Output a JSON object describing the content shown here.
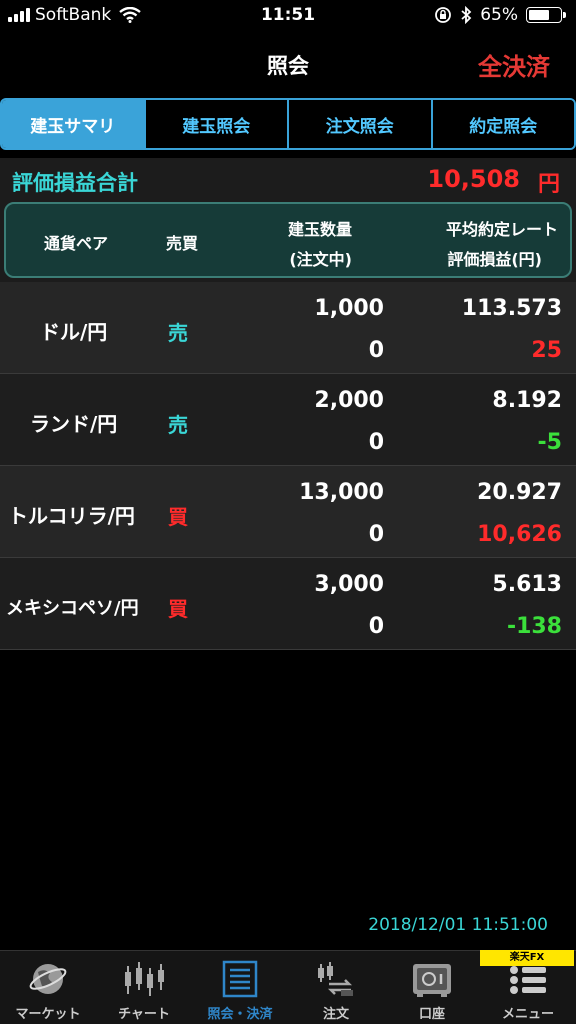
{
  "status_bar": {
    "carrier": "SoftBank",
    "time": "11:51",
    "battery": "65%",
    "battery_level": 0.65
  },
  "nav": {
    "title": "照会",
    "action": "全決済"
  },
  "tabs": [
    {
      "label": "建玉サマリ",
      "active": true
    },
    {
      "label": "建玉照会",
      "active": false
    },
    {
      "label": "注文照会",
      "active": false
    },
    {
      "label": "約定照会",
      "active": false
    }
  ],
  "summary": {
    "label": "評価損益合計",
    "value": "10,508",
    "unit": "円"
  },
  "header": {
    "pair": "通貨ペア",
    "side": "売買",
    "qty_line1": "建玉数量",
    "qty_line2": "(注文中)",
    "rate_line1": "平均約定レート",
    "rate_line2": "評価損益(円)"
  },
  "rows": [
    {
      "pair": "ドル/円",
      "side": "売",
      "qty": "1,000",
      "pending": "0",
      "rate": "113.573",
      "pl": "25"
    },
    {
      "pair": "ランド/円",
      "side": "売",
      "qty": "2,000",
      "pending": "0",
      "rate": "8.192",
      "pl": "-5"
    },
    {
      "pair": "トルコリラ/円",
      "side": "買",
      "qty": "13,000",
      "pending": "0",
      "rate": "20.927",
      "pl": "10,626"
    },
    {
      "pair": "メキシコペソ/円",
      "side": "買",
      "qty": "3,000",
      "pending": "0",
      "rate": "5.613",
      "pl": "-138"
    }
  ],
  "timestamp": "2018/12/01 11:51:00",
  "brand": "楽天FX",
  "tabbar": [
    {
      "label": "マーケット",
      "icon": "globe-icon",
      "active": false
    },
    {
      "label": "チャート",
      "icon": "candlestick-chart-icon",
      "active": false
    },
    {
      "label": "照会・決済",
      "icon": "list-document-icon",
      "active": true
    },
    {
      "label": "注文",
      "icon": "order-exchange-icon",
      "active": false
    },
    {
      "label": "口座",
      "icon": "safe-icon",
      "active": false
    },
    {
      "label": "メニュー",
      "icon": "menu-list-icon",
      "active": false
    }
  ],
  "colors": {
    "accent_blue": "#3aa3d9",
    "sell": "#3ad6d6",
    "buy": "#ff2b2b",
    "profit": "#ff2b2b",
    "loss": "#3be03b",
    "action_red": "#e53935",
    "header_bg": "#163b38"
  }
}
